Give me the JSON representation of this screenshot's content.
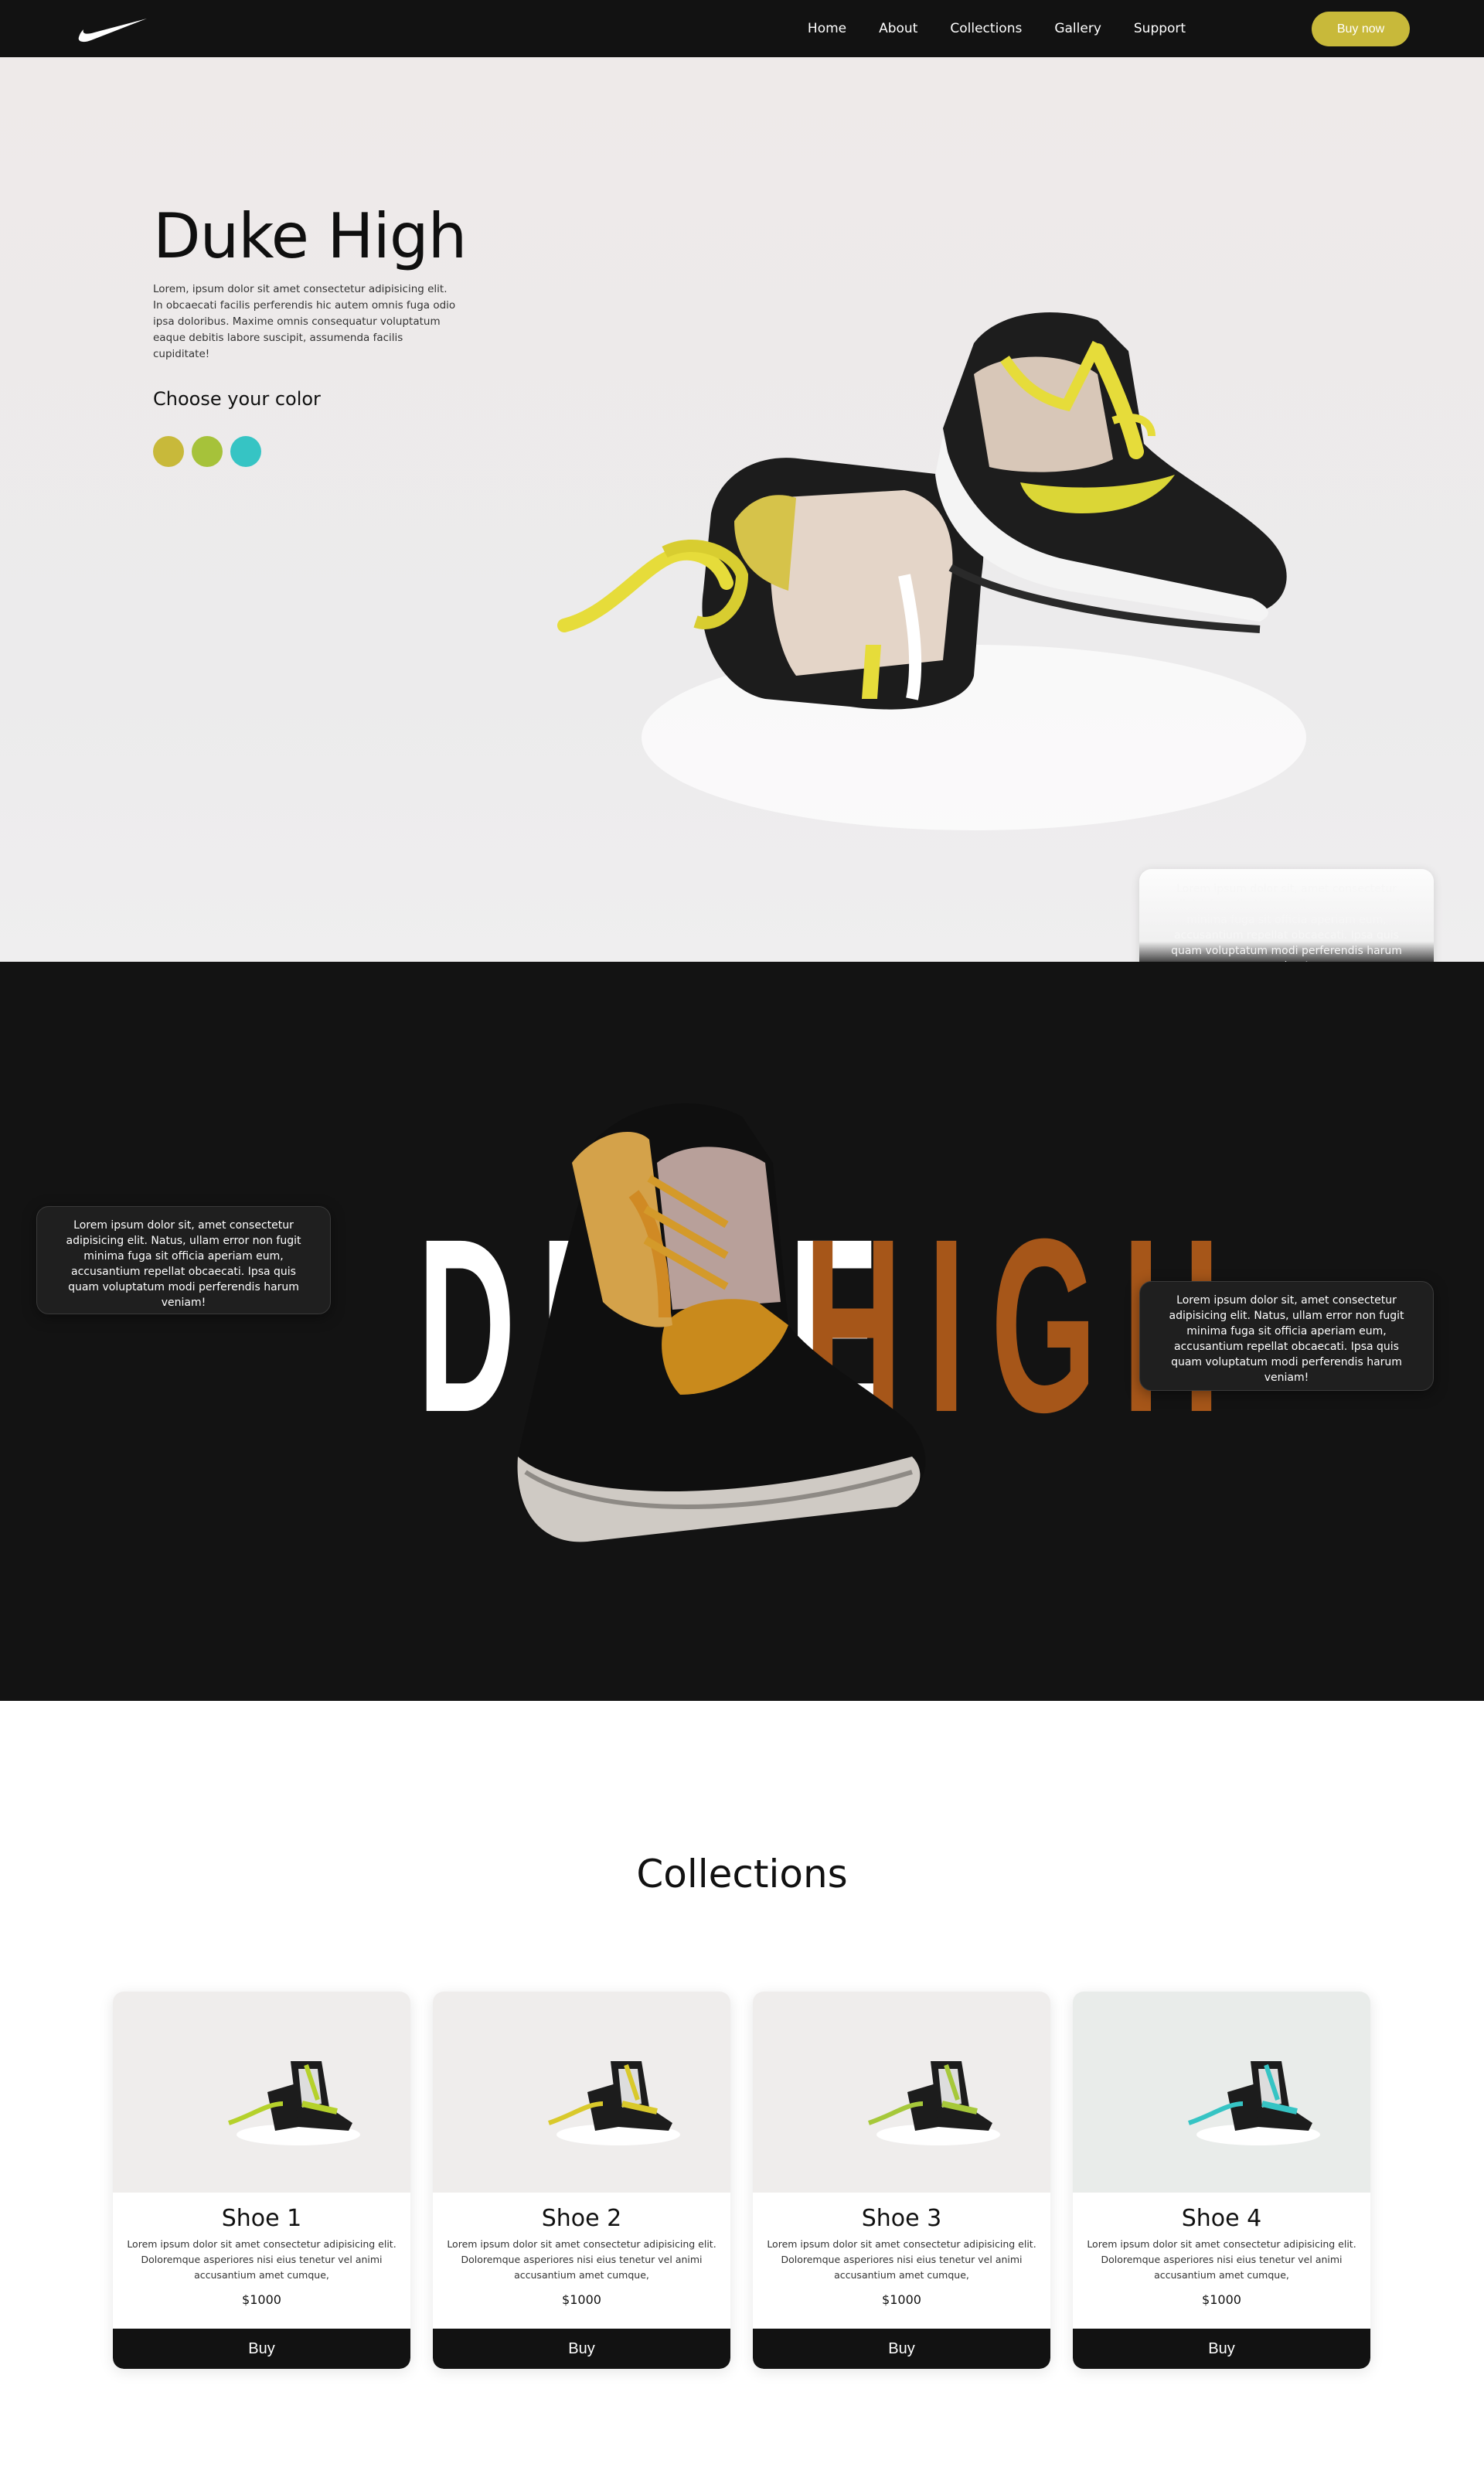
{
  "nav": {
    "logo": "nike-swoosh-logo",
    "links": [
      "Home",
      "About",
      "Collections",
      "Gallery",
      "Support"
    ],
    "buy_label": "Buy now",
    "accent": "#c8b93a"
  },
  "hero": {
    "title": "Duke High",
    "description": "Lorem, ipsum dolor sit amet consectetur adipisicing elit. In obcaecati facilis perferendis hic autem omnis fuga odio ipsa doloribus. Maxime omnis consequatur voluptatum eaque debitis labore suscipit, assumenda facilis cupiditate!",
    "choose_label": "Choose your color",
    "colors": [
      "#c8b93a",
      "#a6c23a",
      "#36c4c4"
    ],
    "card_text": "Lorem ipsum dolor sit, amet consectetur adipisicing elit. Natus, ullam error non fugit minima fuga sit officia aperiam eum, accusantium repellat obcaecati. Ipsa quis quam voluptatum modi perferendis harum veniam!"
  },
  "showcase": {
    "word_left": "DUKE",
    "word_right": "HIGH",
    "left_card_text": "Lorem ipsum dolor sit, amet consectetur adipisicing elit. Natus, ullam error non fugit minima fuga sit officia aperiam eum, accusantium repellat obcaecati. Ipsa quis quam voluptatum modi perferendis harum veniam!",
    "right_card_text": "Lorem ipsum dolor sit, amet consectetur adipisicing elit. Natus, ullam error non fugit minima fuga sit officia aperiam eum, accusantium repellat obcaecati. Ipsa quis quam voluptatum modi perferendis harum veniam!",
    "accent": "#a65619"
  },
  "collections": {
    "title": "Collections",
    "items": [
      {
        "name": "Shoe 1",
        "text": "Lorem ipsum dolor sit amet consectetur adipisicing elit. Doloremque asperiores nisi eius tenetur vel animi accusantium amet cumque,",
        "price": "$1000",
        "buy_label": "Buy",
        "color": "#b5d12b"
      },
      {
        "name": "Shoe 2",
        "text": "Lorem ipsum dolor sit amet consectetur adipisicing elit. Doloremque asperiores nisi eius tenetur vel animi accusantium amet cumque,",
        "price": "$1000",
        "buy_label": "Buy",
        "color": "#d9c92b"
      },
      {
        "name": "Shoe 3",
        "text": "Lorem ipsum dolor sit amet consectetur adipisicing elit. Doloremque asperiores nisi eius tenetur vel animi accusantium amet cumque,",
        "price": "$1000",
        "buy_label": "Buy",
        "color": "#a6c83a"
      },
      {
        "name": "Shoe 4",
        "text": "Lorem ipsum dolor sit amet consectetur adipisicing elit. Doloremque asperiores nisi eius tenetur vel animi accusantium amet cumque,",
        "price": "$1000",
        "buy_label": "Buy",
        "color": "#36c4c4"
      }
    ]
  }
}
